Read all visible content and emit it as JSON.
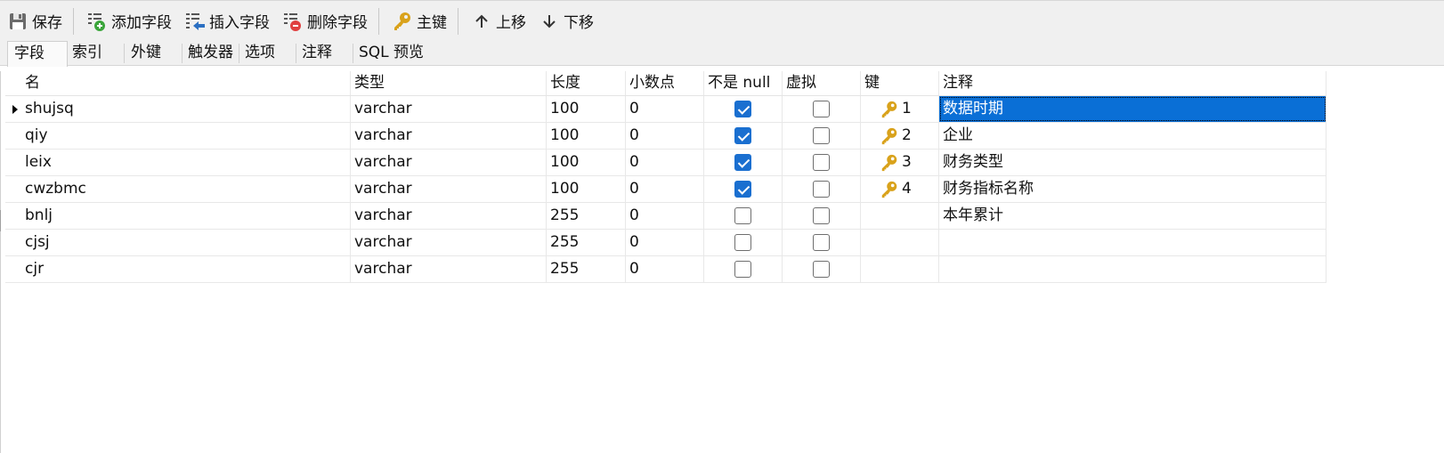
{
  "toolbar": {
    "save_label": "保存",
    "add_field_label": "添加字段",
    "insert_field_label": "插入字段",
    "delete_field_label": "删除字段",
    "primary_key_label": "主键",
    "move_up_label": "上移",
    "move_down_label": "下移"
  },
  "tabs": [
    "字段",
    "索引",
    "外键",
    "触发器",
    "选项",
    "注释",
    "SQL 预览"
  ],
  "grid": {
    "headers": {
      "name": "名",
      "type": "类型",
      "length": "长度",
      "decimals": "小数点",
      "not_null": "不是 null",
      "virtual": "虚拟",
      "key": "键",
      "comment": "注释"
    },
    "rows": [
      {
        "name": "shujsq",
        "type": "varchar",
        "length": "100",
        "decimals": "0",
        "not_null": true,
        "virtual": false,
        "key": "1",
        "comment": "数据时期"
      },
      {
        "name": "qiy",
        "type": "varchar",
        "length": "100",
        "decimals": "0",
        "not_null": true,
        "virtual": false,
        "key": "2",
        "comment": "企业"
      },
      {
        "name": "leix",
        "type": "varchar",
        "length": "100",
        "decimals": "0",
        "not_null": true,
        "virtual": false,
        "key": "3",
        "comment": "财务类型"
      },
      {
        "name": "cwzbmc",
        "type": "varchar",
        "length": "100",
        "decimals": "0",
        "not_null": true,
        "virtual": false,
        "key": "4",
        "comment": "财务指标名称"
      },
      {
        "name": "bnlj",
        "type": "varchar",
        "length": "255",
        "decimals": "0",
        "not_null": false,
        "virtual": false,
        "key": "",
        "comment": "本年累计"
      },
      {
        "name": "cjsj",
        "type": "varchar",
        "length": "255",
        "decimals": "0",
        "not_null": false,
        "virtual": false,
        "key": "",
        "comment": ""
      },
      {
        "name": "cjr",
        "type": "varchar",
        "length": "255",
        "decimals": "0",
        "not_null": false,
        "virtual": false,
        "key": "",
        "comment": ""
      }
    ]
  },
  "colors": {
    "selection": "#0a6fd6",
    "checkbox_checked": "#1a6fd0",
    "key_icon": "#d9a21b",
    "toolbar_bg": "#f0f0f0"
  },
  "icons": {
    "save": "save-icon",
    "add_field": "add-field-icon",
    "insert_field": "insert-field-icon",
    "delete_field": "delete-field-icon",
    "primary_key": "key-icon",
    "move_up": "arrow-up-icon",
    "move_down": "arrow-down-icon"
  }
}
